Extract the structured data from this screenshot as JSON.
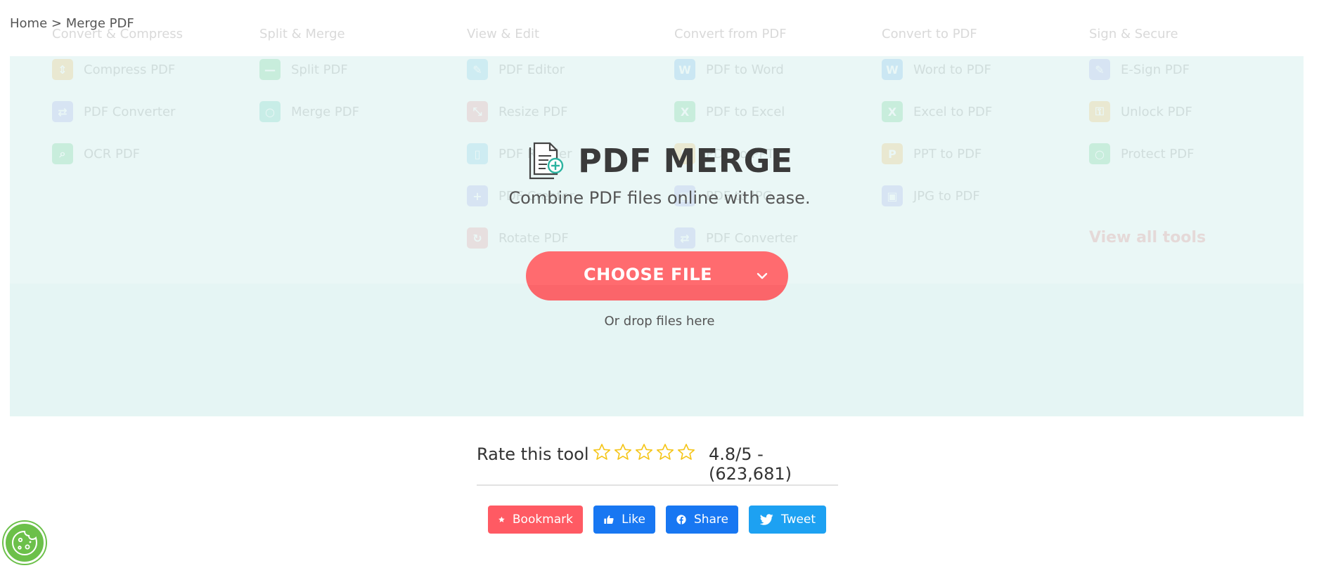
{
  "breadcrumb": {
    "home": "Home",
    "separator": ">",
    "current": "Merge PDF"
  },
  "menu": {
    "columns": [
      {
        "heading": "Convert & Compress",
        "items": [
          {
            "label": "Compress PDF",
            "icon": "compress-icon",
            "color": "#ffb84d"
          },
          {
            "label": "PDF Converter",
            "icon": "converter-icon",
            "color": "#8c8cff"
          },
          {
            "label": "OCR PDF",
            "icon": "ocr-icon",
            "color": "#3cc96d"
          }
        ]
      },
      {
        "heading": "Split & Merge",
        "items": [
          {
            "label": "Split PDF",
            "icon": "split-icon",
            "color": "#3cc96d"
          },
          {
            "label": "Merge PDF",
            "icon": "merge-icon",
            "color": "#3cc9b0"
          }
        ]
      },
      {
        "heading": "View & Edit",
        "items": [
          {
            "label": "PDF Editor",
            "icon": "editor-icon",
            "color": "#5fc7f0"
          },
          {
            "label": "Resize PDF",
            "icon": "resize-icon",
            "color": "#ff6b6f"
          },
          {
            "label": "PDF Reader",
            "icon": "reader-icon",
            "color": "#5fc7f0"
          },
          {
            "label": "PDF Creator",
            "icon": "creator-icon",
            "color": "#8c8cff"
          },
          {
            "label": "Rotate PDF",
            "icon": "rotate-icon",
            "color": "#ff6b6f"
          }
        ]
      },
      {
        "heading": "Convert from PDF",
        "items": [
          {
            "label": "PDF to Word",
            "icon": "word-icon",
            "color": "#3aa8f5"
          },
          {
            "label": "PDF to Excel",
            "icon": "excel-icon",
            "color": "#3cc96d"
          },
          {
            "label": "PDF to PPT",
            "icon": "ppt-icon",
            "color": "#ffb84d"
          },
          {
            "label": "PDF to JPG",
            "icon": "jpg-icon",
            "color": "#8c8cff"
          },
          {
            "label": "PDF Converter",
            "icon": "converter-icon",
            "color": "#8c8cff"
          }
        ]
      },
      {
        "heading": "Convert to PDF",
        "items": [
          {
            "label": "Word to PDF",
            "icon": "word-icon",
            "color": "#3aa8f5"
          },
          {
            "label": "Excel to PDF",
            "icon": "excel-icon",
            "color": "#3cc96d"
          },
          {
            "label": "PPT to PDF",
            "icon": "ppt-icon",
            "color": "#ffb84d"
          },
          {
            "label": "JPG to PDF",
            "icon": "jpg-icon",
            "color": "#8c8cff"
          }
        ]
      },
      {
        "heading": "Sign & Secure",
        "items": [
          {
            "label": "E-Sign PDF",
            "icon": "esign-icon",
            "color": "#8c8cff"
          },
          {
            "label": "Unlock PDF",
            "icon": "unlock-icon",
            "color": "#ffb84d"
          },
          {
            "label": "Protect PDF",
            "icon": "protect-icon",
            "color": "#3cc96d"
          }
        ]
      }
    ],
    "view_all": "View all tools"
  },
  "hero": {
    "title": "PDF MERGE",
    "subtitle": "Combine PDF files online with ease.",
    "choose_label": "CHOOSE FILE",
    "drop_text": "Or drop files here"
  },
  "rating": {
    "label": "Rate this tool",
    "stars_total": 5,
    "value_text": "4.8/5 - (623,681)",
    "star_color": "#f5c518"
  },
  "share": {
    "bookmark": "Bookmark",
    "like": "Like",
    "share": "Share",
    "tweet": "Tweet"
  },
  "colors": {
    "accent": "#ff6b6f",
    "panel": "#e9f7f6",
    "facebook": "#1877f2",
    "twitter": "#1da1f2",
    "cookie": "#6cc04a"
  }
}
